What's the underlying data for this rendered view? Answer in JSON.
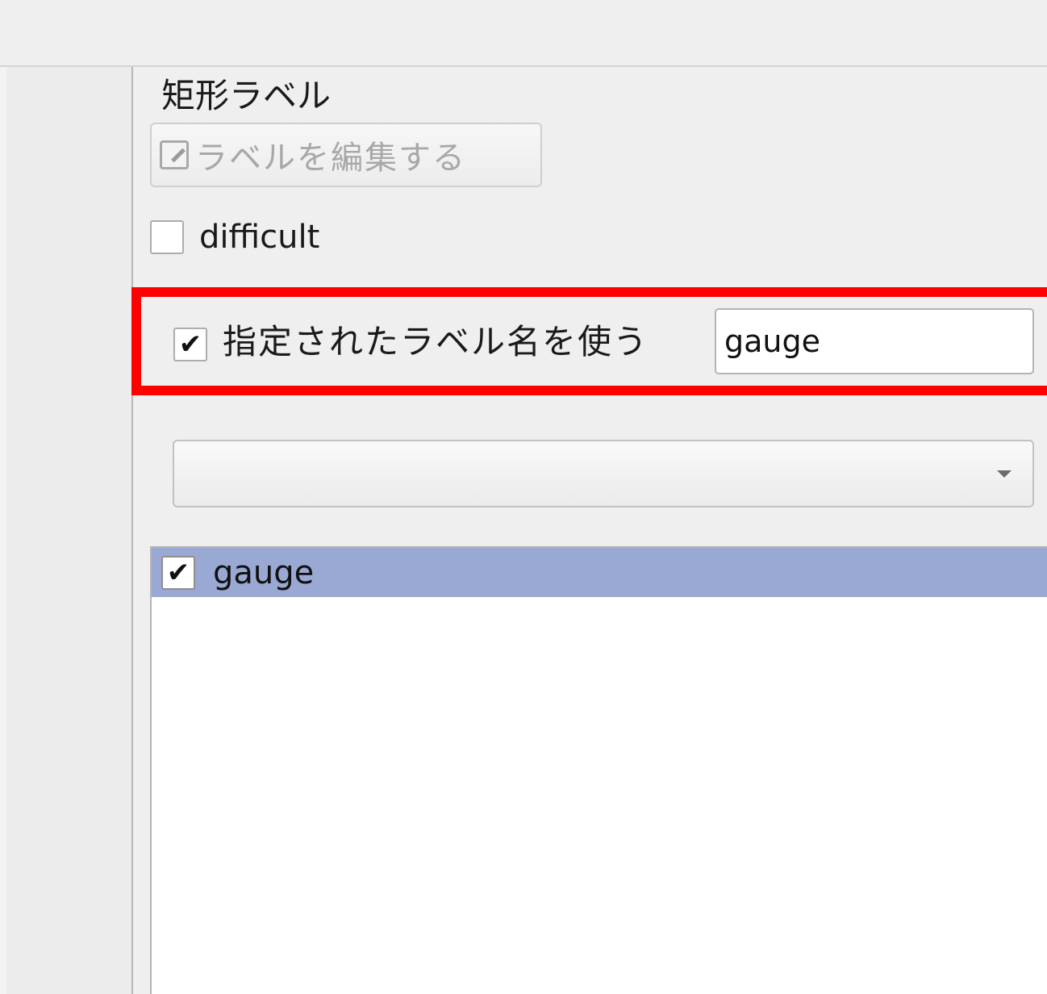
{
  "dock": {
    "title": "矩形ラベル",
    "edit_button_label": "ラベルを編集する",
    "difficult": {
      "label": "difficult",
      "checked": false
    },
    "use_default_label": {
      "label": "指定されたラベル名を使う",
      "checked": true,
      "check_glyph": "✔",
      "value": "gauge"
    },
    "combo": {
      "selected": ""
    },
    "label_list": {
      "items": [
        {
          "label": "gauge",
          "checked": true,
          "check_glyph": "✔",
          "selected": true
        }
      ]
    },
    "highlight_color": "#ff0000",
    "selection_color": "#9aa9d4"
  }
}
